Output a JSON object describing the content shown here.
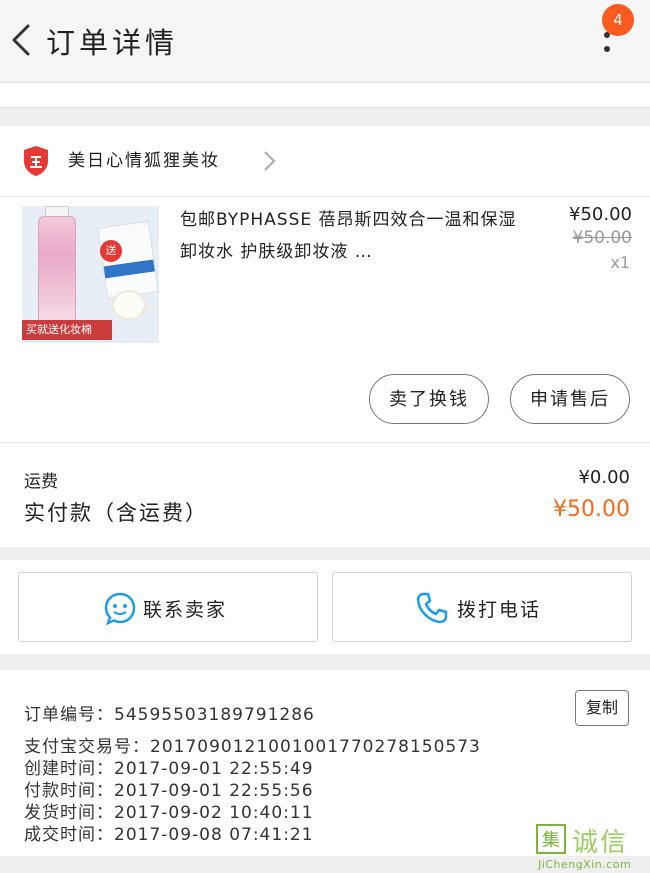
{
  "header": {
    "title": "订单详情",
    "badge_count": "4"
  },
  "shop": {
    "name": "美日心情狐狸美妆"
  },
  "product": {
    "title": "包邮BYPHASSE 蓓昂斯四效合一温和保湿卸妆水 护肤级卸妆液 …",
    "image_caption": "买就送化妆棉",
    "gift_tag": "送",
    "price": "¥50.00",
    "original_price": "¥50.00",
    "quantity": "x1"
  },
  "actions": {
    "refund_label": "卖了换钱",
    "after_sale_label": "申请售后"
  },
  "totals": {
    "shipping_label": "运费",
    "shipping_value": "¥0.00",
    "paid_label": "实付款（含运费）",
    "paid_value": "¥50.00"
  },
  "contact": {
    "seller_label": "联系卖家",
    "phone_label": "拨打电话"
  },
  "order_info": {
    "copy_label": "复制",
    "lines": [
      "订单编号：545955031897912​86",
      "支付宝交易号：2017090121001001770278150573",
      "创建时间：2017-09-01  22:55:49",
      "付款时间：2017-09-01  22:55:56",
      "发货时间：2017-09-02  10:40:11",
      "成交时间：2017-09-08  07:41:21"
    ]
  },
  "watermark": {
    "mark": "集",
    "text": "诚信",
    "url": "JiChengXin.com"
  },
  "colors": {
    "accent_orange": "#f36b1e",
    "badge_orange": "#ff5a1f",
    "shop_shield_red": "#e53935",
    "contact_icon_blue": "#1e9be6"
  }
}
